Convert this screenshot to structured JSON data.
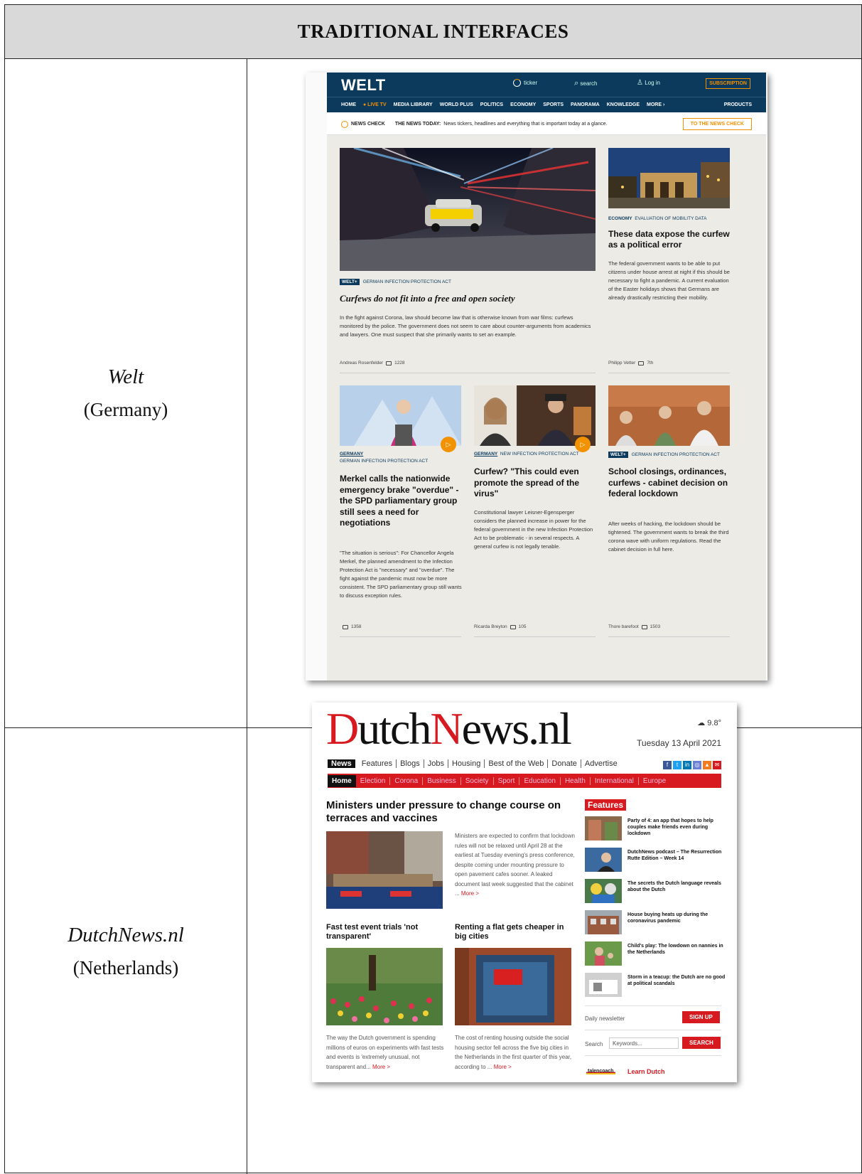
{
  "table": {
    "header": "TRADITIONAL INTERFACES",
    "rows": [
      {
        "name": "Welt",
        "country": "(Germany)"
      },
      {
        "name": "DutchNews.nl",
        "country": "(Netherlands)"
      }
    ]
  },
  "welt": {
    "logo": "WELT",
    "top": {
      "ticker": "ticker",
      "search": "search",
      "login": "Log in",
      "subscription": "SUBSCRIPTION"
    },
    "nav": [
      "HOME",
      "● LIVE TV",
      "MEDIA LIBRARY",
      "WORLD PLUS",
      "POLITICS",
      "ECONOMY",
      "SPORTS",
      "PANORAMA",
      "KNOWLEDGE",
      "MORE ›",
      "PRODUCTS"
    ],
    "check": {
      "label": "NEWS CHECK",
      "today": "THE NEWS TODAY:",
      "text": "News tickers, headlines and everything that is important today at a glance.",
      "button": "TO THE NEWS CHECK"
    },
    "main": {
      "badge": "WELT+",
      "tag": "GERMAN INFECTION PROTECTION ACT",
      "headline": "Curfews do not fit into a free and open society",
      "text": "In the fight against Corona, law should become law that is otherwise known from war films: curfews monitored by the police. The government does not seem to care about counter-arguments from academics and lawyers. One must suspect that she primarily wants to set an example.",
      "author": "Andreas Rosenfelder",
      "comments": "1228"
    },
    "side": {
      "tag1": "ECONOMY",
      "tag2": "EVALUATION OF MOBILITY DATA",
      "headline": "These data expose the curfew as a political error",
      "text": "The federal government wants to be able to put citizens under house arrest at night if this should be necessary to fight a pandemic. A current evaluation of the Easter holidays shows that Germans are already drastically restricting their mobility.",
      "author": "Philipp Vetter",
      "comments": "7th"
    },
    "cards": [
      {
        "tag1": "GERMANY",
        "tag2": "GERMAN INFECTION PROTECTION ACT",
        "headline": "Merkel calls the nationwide emergency brake \"overdue\" - the SPD parliamentary group still sees a need for negotiations",
        "text": "\"The situation is serious\": For Chancellor Angela Merkel, the planned amendment to the Infection Protection Act is \"necessary\" and \"overdue\". The fight against the pandemic must now be more consistent. The SPD parliamentary group still wants to discuss exception rules.",
        "author": "",
        "comments": "1358"
      },
      {
        "tag1": "GERMANY",
        "tag2": "NEW INFECTION PROTECTION ACT",
        "headline": "Curfew? \"This could even promote the spread of the virus\"",
        "text": "Constitutional lawyer Leisner-Egensperger considers the planned increase in power for the federal government in the new Infection Protection Act to be problematic - in several respects. A general curfew is not legally tenable.",
        "author": "Ricarda Breyton",
        "comments": "105"
      },
      {
        "badge": "WELT+",
        "tag2": "GERMAN INFECTION PROTECTION ACT",
        "headline": "School closings, ordinances, curfews - cabinet decision on federal lockdown",
        "text": "After weeks of hacking, the lockdown should be tightened. The government wants to break the third corona wave with uniform regulations. Read the cabinet decision in full here.",
        "author": "Thore barefoot",
        "comments": "1503"
      }
    ]
  },
  "dutch": {
    "logo_a": "D",
    "logo_b": "utch",
    "logo_c": "N",
    "logo_d": "ews.nl",
    "weather": "9.8°",
    "date": "Tuesday 13 April 2021",
    "nav1": [
      "News",
      "Features",
      "Blogs",
      "Jobs",
      "Housing",
      "Best of the Web",
      "Donate",
      "Advertise"
    ],
    "social": [
      "f",
      "t",
      "in",
      "◎",
      "▲",
      "✉"
    ],
    "nav2": [
      "Home",
      "Election",
      "Corona",
      "Business",
      "Society",
      "Sport",
      "Education",
      "Health",
      "International",
      "Europe"
    ],
    "lead": {
      "headline": "Ministers under pressure to change course on terraces and vaccines",
      "text": "Ministers are expected to confirm that lockdown rules will not be relaxed until April 28 at the earliest at Tuesday evening's press conference, despite coming under mounting pressure to open pavement cafes sooner. A leaked document last week suggested that the cabinet ...",
      "more": "More >"
    },
    "story1": {
      "headline": "Fast test event trials 'not transparent'",
      "text": "The way the Dutch government is spending millions of euros on experiments with fast tests and events is 'extremely unusual, not transparent and...",
      "more": "More >"
    },
    "story2": {
      "headline": "Renting a flat gets cheaper in big cities",
      "text": "The cost of renting housing outside the social housing sector fell across the five big cities in the Netherlands in the first quarter of this year, according to ...",
      "more": "More >"
    },
    "features_title": "Features",
    "features": [
      "Party of 4: an app that hopes to help couples make friends even during lockdown",
      "DutchNews podcast – The Resurrection Rutte Edition – Week 14",
      "The secrets the Dutch language reveals about the Dutch",
      "House buying heats up during the coronavirus pandemic",
      "Child's play: The lowdown on nannies in the Netherlands",
      "Storm in a teacup: the Dutch are no good at political scandals"
    ],
    "newsletter": "Daily newsletter",
    "signup": "SIGN UP",
    "search_label": "Search",
    "search_placeholder": "Keywords...",
    "search_button": "SEARCH",
    "learn_logo": "talencoach",
    "learn": "Learn Dutch"
  },
  "colors": {
    "welt_navy": "#0b3a5d",
    "welt_orange": "#f39200",
    "dutch_red": "#d71920"
  }
}
